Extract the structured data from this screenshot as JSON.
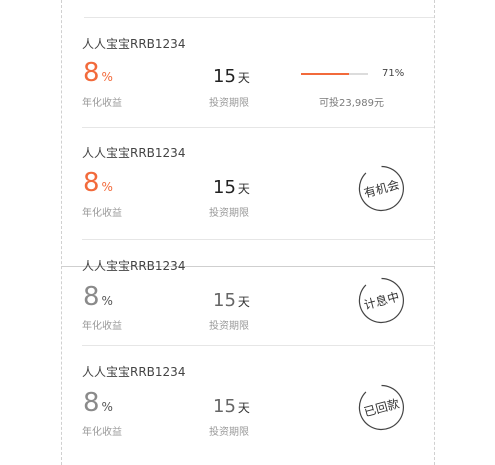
{
  "products": [
    {
      "name": "人人宝宝RRB1234",
      "rate": "8",
      "rate_unit": "%",
      "rate_label": "年化收益",
      "term": "15",
      "term_unit": "天",
      "term_label": "投资期限",
      "progress_percent": 71,
      "progress_text": "71%",
      "available_text": "可投23,989元"
    },
    {
      "name": "人人宝宝RRB1234",
      "rate": "8",
      "rate_unit": "%",
      "rate_label": "年化收益",
      "term": "15",
      "term_unit": "天",
      "term_label": "投资期限",
      "status": "有机会"
    },
    {
      "name": "人人宝宝RRB1234",
      "rate": "8",
      "rate_unit": "%",
      "rate_label": "年化收益",
      "term": "15",
      "term_unit": "天",
      "term_label": "投资期限",
      "status": "计息中"
    },
    {
      "name": "人人宝宝RRB1234",
      "rate": "8",
      "rate_unit": "%",
      "rate_label": "年化收益",
      "term": "15",
      "term_unit": "天",
      "term_label": "投资期限",
      "status": "已回款"
    }
  ],
  "colors": {
    "accent": "#f26a3b",
    "muted_number": "#8a8a8a",
    "divider": "#e6e6e6"
  }
}
